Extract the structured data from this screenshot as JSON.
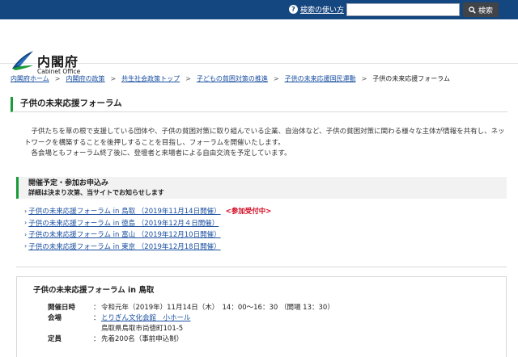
{
  "search": {
    "help_label": "検索の使い方",
    "placeholder": "",
    "button_label": "検索"
  },
  "logo": {
    "ja": "内閣府",
    "en": "Cabinet Office"
  },
  "breadcrumb": [
    "内閣府ホーム",
    "内閣府の政策",
    "共生社会政策トップ",
    "子どもの貧困対策の推進",
    "子供の未来応援国民運動",
    "子供の未来応援フォーラム"
  ],
  "page_title": "子供の未来応援フォーラム",
  "intro": [
    "子供たちを草の根で支援している団体や、子供の貧困対策に取り組んでいる企業、自治体など、子供の貧困対策に関わる様々な主体が情報を共有し、ネットワークを構築することを後押しすることを目指し、フォーラムを開催いたします。",
    "各会場ともフォーラム終了後に、登壇者と来場者による自由交流を予定しています。"
  ],
  "schedule": {
    "heading": "開催予定・参加お申込み",
    "subheading": "詳細は決まり次第、当サイトでお知らせします",
    "events": [
      {
        "label": "子供の未来応援フォーラム in 鳥取 （2019年11月14日開催）",
        "badge": "<参加受付中>"
      },
      {
        "label": "子供の未来応援フォーラム in 徳島 （2019年12月４日開催）",
        "badge": ""
      },
      {
        "label": "子供の未来応援フォーラム in 富山 （2019年12月10日開催）",
        "badge": ""
      },
      {
        "label": "子供の未来応援フォーラム in 東京 （2019年12月18日開催）",
        "badge": ""
      }
    ]
  },
  "detail": {
    "title": "子供の未来応援フォーラム in 鳥取",
    "rows": [
      {
        "label": "開催日時",
        "value": "令和元年（2019年）11月14日（木）　14：00～16：30 （開場 13：30）",
        "value2": ""
      },
      {
        "label": "会場",
        "value": "とりぎん文化会館　小ホール",
        "value2": "鳥取県鳥取市尚徳町101-5"
      },
      {
        "label": "定員",
        "value": "先着200名（事前申込制）",
        "value2": ""
      }
    ]
  },
  "colors": {
    "topbar": "#14467f",
    "accent_green": "#1a9b3a",
    "link": "#1a4fa0",
    "alert_red": "#d0021b"
  }
}
